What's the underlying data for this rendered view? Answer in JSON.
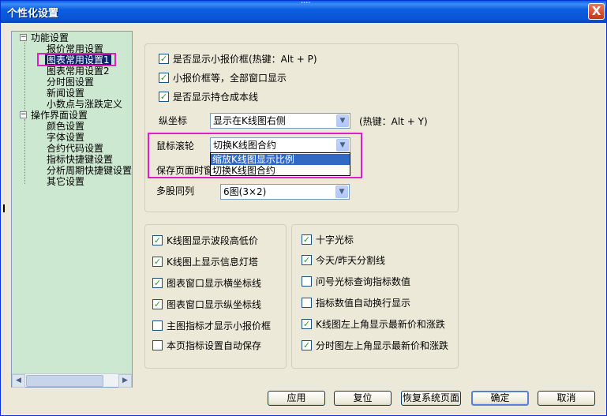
{
  "window": {
    "title": "个性化设置",
    "close_label": "X",
    "grip": "····"
  },
  "tree": {
    "groups": [
      {
        "label": "功能设置",
        "expander": "−",
        "children": [
          {
            "label": "报价常用设置",
            "selected": false
          },
          {
            "label": "图表常用设置1",
            "selected": true
          },
          {
            "label": "图表常用设置2",
            "selected": false
          },
          {
            "label": "分时图设置",
            "selected": false
          },
          {
            "label": "新闻设置",
            "selected": false
          },
          {
            "label": "小数点与涨跌定义",
            "selected": false
          }
        ]
      },
      {
        "label": "操作界面设置",
        "expander": "−",
        "children": [
          {
            "label": "颜色设置",
            "selected": false
          },
          {
            "label": "字体设置",
            "selected": false
          },
          {
            "label": "合约代码设置",
            "selected": false
          },
          {
            "label": "指标快捷键设置",
            "selected": false
          },
          {
            "label": "分析周期快捷键设置",
            "selected": false
          },
          {
            "label": "其它设置",
            "selected": false
          }
        ]
      }
    ],
    "scroll_left": "◀",
    "scroll_right": "▶"
  },
  "top_section": {
    "checkboxes": [
      {
        "label": "是否显示小报价框(热键：Alt + P)",
        "checked": true
      },
      {
        "label": "小报价框等，全部窗口显示",
        "checked": true
      },
      {
        "label": "是否显示持仓成本线",
        "checked": true
      }
    ],
    "y_axis": {
      "label": "纵坐标",
      "value": "显示在K线图右侧",
      "hotkey": "(热键：Alt + Y)"
    },
    "mouse_wheel": {
      "label": "鼠标滚轮",
      "value": "切换K线图合约",
      "options": [
        {
          "label": "缩放K线图显示比例",
          "highlighted": true
        },
        {
          "label": "切换K线图合约",
          "highlighted": false
        }
      ]
    },
    "save_page": {
      "label": "保存页面时窗"
    },
    "multi_stock": {
      "label": "多股同列",
      "value": "6图(3×2)"
    }
  },
  "left_section": {
    "checkboxes": [
      {
        "label": "K线图显示波段高低价",
        "checked": true
      },
      {
        "label": "K线图上显示信息灯塔",
        "checked": true
      },
      {
        "label": "图表窗口显示横坐标线",
        "checked": true
      },
      {
        "label": "图表窗口显示纵坐标线",
        "checked": true
      },
      {
        "label": "主图指标才显示小报价框",
        "checked": false
      },
      {
        "label": "本页指标设置自动保存",
        "checked": false
      }
    ]
  },
  "right_section": {
    "checkboxes": [
      {
        "label": "十字光标",
        "checked": true
      },
      {
        "label": "今天/昨天分割线",
        "checked": true
      },
      {
        "label": "问号光标查询指标数值",
        "checked": false
      },
      {
        "label": "指标数值自动换行显示",
        "checked": false
      },
      {
        "label": "K线图左上角显示最新价和涨跌",
        "checked": true
      },
      {
        "label": "分时图左上角显示最新价和涨跌",
        "checked": true
      }
    ]
  },
  "buttons": {
    "apply": "应用",
    "reset": "复位",
    "restore_system": "恢复系统页面",
    "ok": "确定",
    "cancel": "取消"
  },
  "icons": {
    "check": "✓",
    "dropdown": "▼"
  },
  "colors": {
    "title_bar": "#0a5ee0",
    "tree_bg": "#cde8d0",
    "highlight_border": "#e01ec8",
    "selection": "#316ac5",
    "check": "#21a121"
  }
}
